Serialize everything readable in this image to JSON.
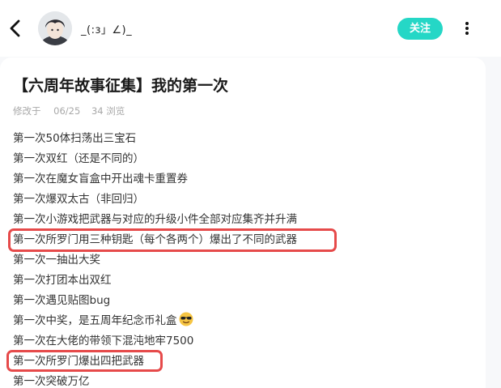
{
  "header": {
    "back_icon": "chevron-left-icon",
    "username": "_(:з」∠)_",
    "follow_label": "关注",
    "more_icon": "vertical-dots-icon",
    "accent": "#25d7c6"
  },
  "post": {
    "title": "【六周年故事征集】我的第一次",
    "meta": {
      "modified": "修改于",
      "date": "06/25",
      "views": "34 浏览"
    },
    "items": [
      "第一次50体扫荡出三宝石",
      "第一次双红（还是不同的）",
      "第一次在魔女盲盒中开出魂卡重置券",
      "第一次爆双太古（非回归）",
      "第一次小游戏把武器与对应的升级小件全部对应集齐并升满",
      "第一次所罗门用三种钥匙（每个各两个）爆出了不同的武器",
      "第一次一抽出大奖",
      "第一次打团本出双红",
      "第一次遇见贴图bug",
      "第一次中奖，是五周年纪念币礼盒",
      "第一次在大佬的带领下混沌地牢7500",
      "第一次所罗门爆出四把武器",
      "第一次突破万亿"
    ],
    "highlight_color": "#e64a4a"
  }
}
